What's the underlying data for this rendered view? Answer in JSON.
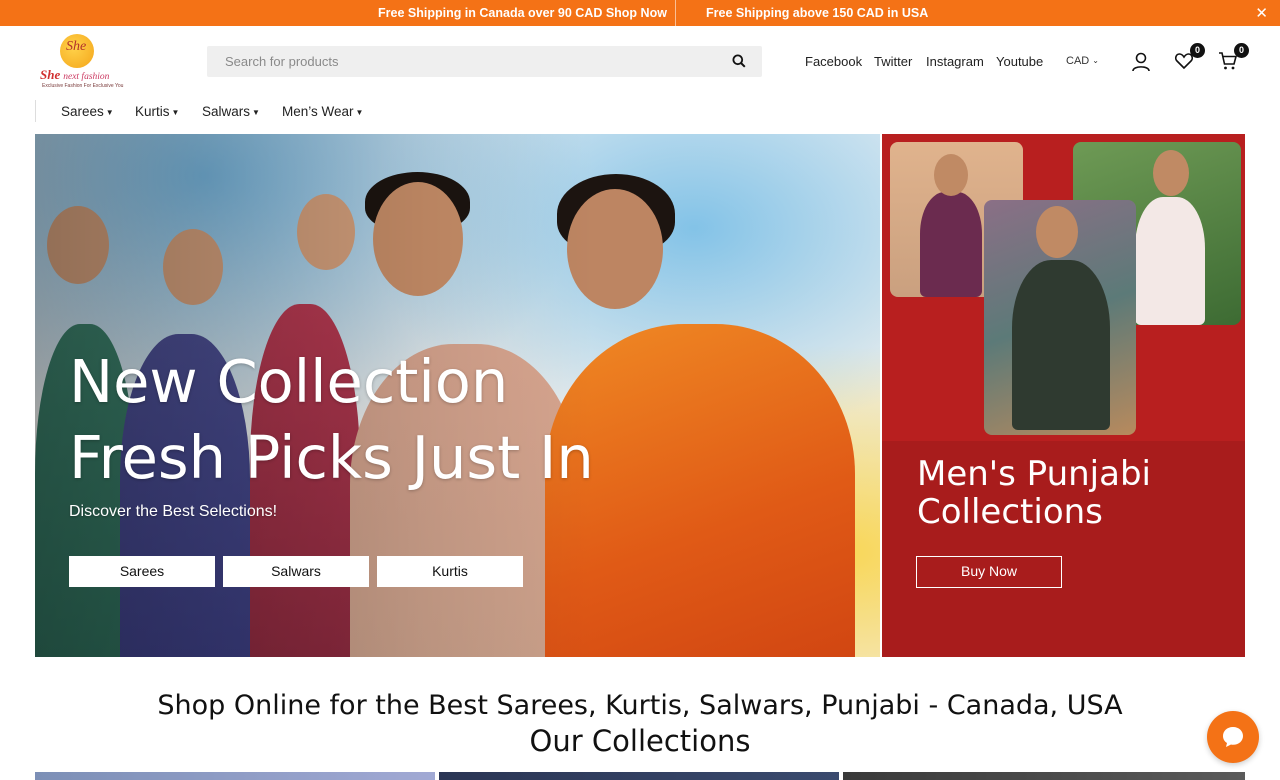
{
  "promo": {
    "message1": "Free Shipping in Canada over 90 CAD Shop Now",
    "message2": "Free Shipping above 150 CAD in USA",
    "close_icon": "close-icon",
    "bg_color": "#f47216"
  },
  "header": {
    "logo": {
      "sun_text": "She",
      "brand_she": "She",
      "brand_rest": "next fashion",
      "tagline": "Exclusive Fashion For Exclusive You"
    },
    "search": {
      "placeholder": "Search for products",
      "icon": "search-icon"
    },
    "social_links": [
      "Facebook",
      "Twitter",
      "Instagram",
      "Youtube"
    ],
    "currency": "CAD",
    "account_icon": "user-icon",
    "wishlist": {
      "icon": "heart-icon",
      "count": "0"
    },
    "cart": {
      "icon": "cart-icon",
      "count": "0"
    }
  },
  "nav": {
    "items": [
      {
        "label": "Sarees"
      },
      {
        "label": "Kurtis"
      },
      {
        "label": "Salwars"
      },
      {
        "label": "Men’s Wear"
      }
    ]
  },
  "hero": {
    "title_line1": "New Collection",
    "title_line2": "Fresh Picks Just In",
    "subtitle": "Discover the Best Selections!",
    "buttons": [
      "Sarees",
      "Salwars",
      "Kurtis"
    ]
  },
  "side_banner": {
    "title_line1": "Men's Punjabi",
    "title_line2": "Collections",
    "button": "Buy Now",
    "bg_color": "#b81f1f"
  },
  "section": {
    "heading": "Shop Online for the Best Sarees, Kurtis, Salwars, Punjabi - Canada, USA",
    "subheading": "Our Collections"
  },
  "chat": {
    "icon": "chat-icon",
    "color": "#f47216"
  }
}
